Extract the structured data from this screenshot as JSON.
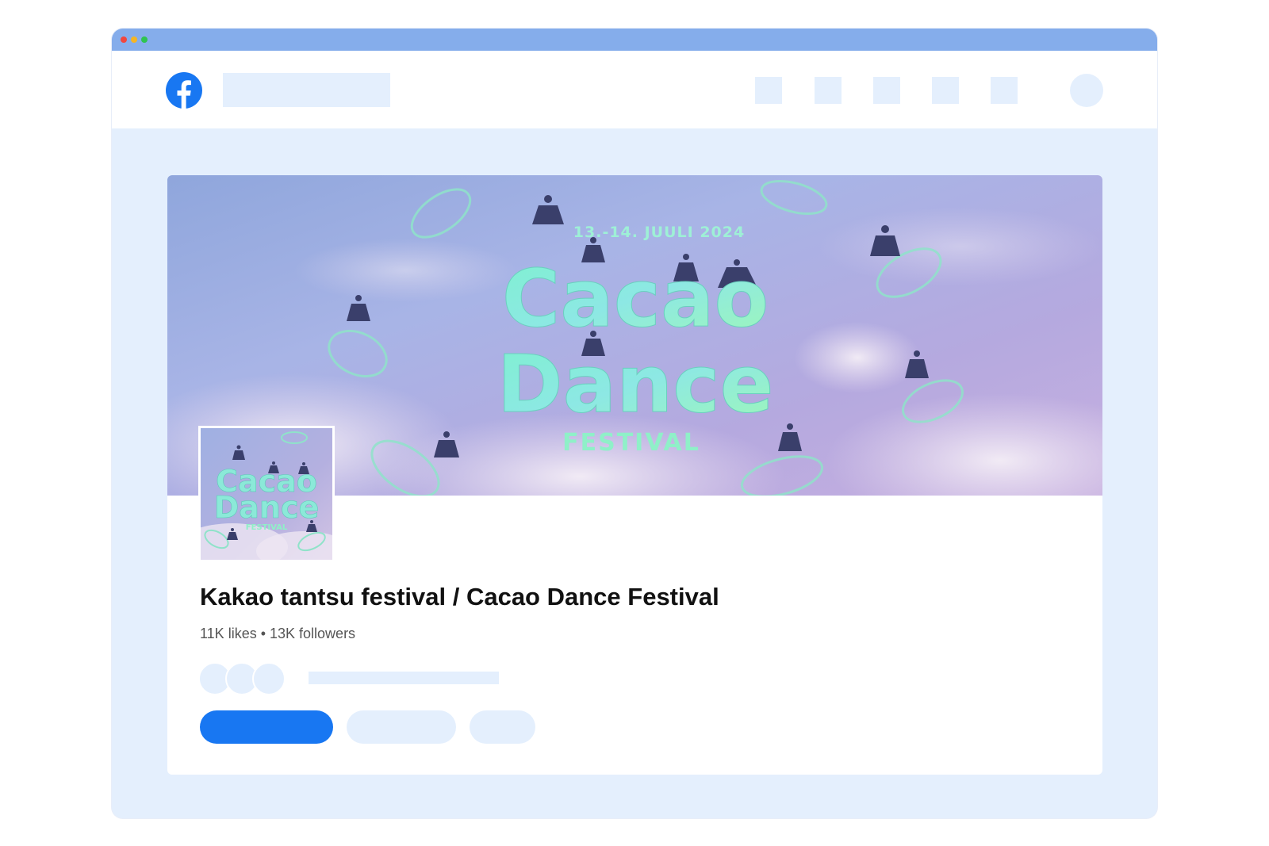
{
  "window": {
    "controls": [
      "close",
      "minimize",
      "maximize"
    ],
    "colors": {
      "close": "#f0473e",
      "minimize": "#f5b524",
      "maximize": "#2fc451",
      "title_bar": "#85adeb"
    }
  },
  "nav": {
    "logo_icon": "facebook-logo-icon",
    "brand_color": "#1877f2",
    "nav_icon_count": 5
  },
  "cover": {
    "date_text": "13.-14. JUULI 2024",
    "title_line1": "Cacao",
    "title_line2": "Dance",
    "title_line3": "FESTIVAL"
  },
  "profile_picture": {
    "title_line1": "Cacao",
    "title_line2": "Dance",
    "title_line3": "FESTIVAL"
  },
  "page": {
    "name": "Kakao tantsu festival / Cacao Dance Festival",
    "stats": "11K likes • 13K followers"
  },
  "actions": {
    "primary_color": "#1877f2",
    "placeholder_color": "#e4effd"
  }
}
